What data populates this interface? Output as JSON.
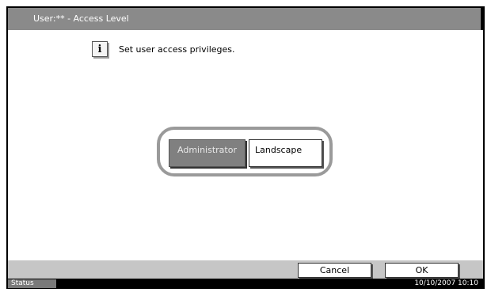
{
  "title_bar": {
    "title": "User:** - Access Level"
  },
  "info": {
    "icon": "info-icon",
    "glyph": "i",
    "message": "Set user access privileges."
  },
  "choices": [
    {
      "label": "Administrator",
      "selected": true
    },
    {
      "label": "Landscape",
      "selected": false
    }
  ],
  "buttons": {
    "cancel_label": "Cancel",
    "ok_label": "OK"
  },
  "status_bar": {
    "status_label": "Status",
    "datetime": "10/10/2007   10:10"
  },
  "colors": {
    "title_bar": "#8a8a8a",
    "selected_button": "#808080",
    "bottom_bar": "#c6c6c6",
    "status_label": "#7a7a7a"
  }
}
